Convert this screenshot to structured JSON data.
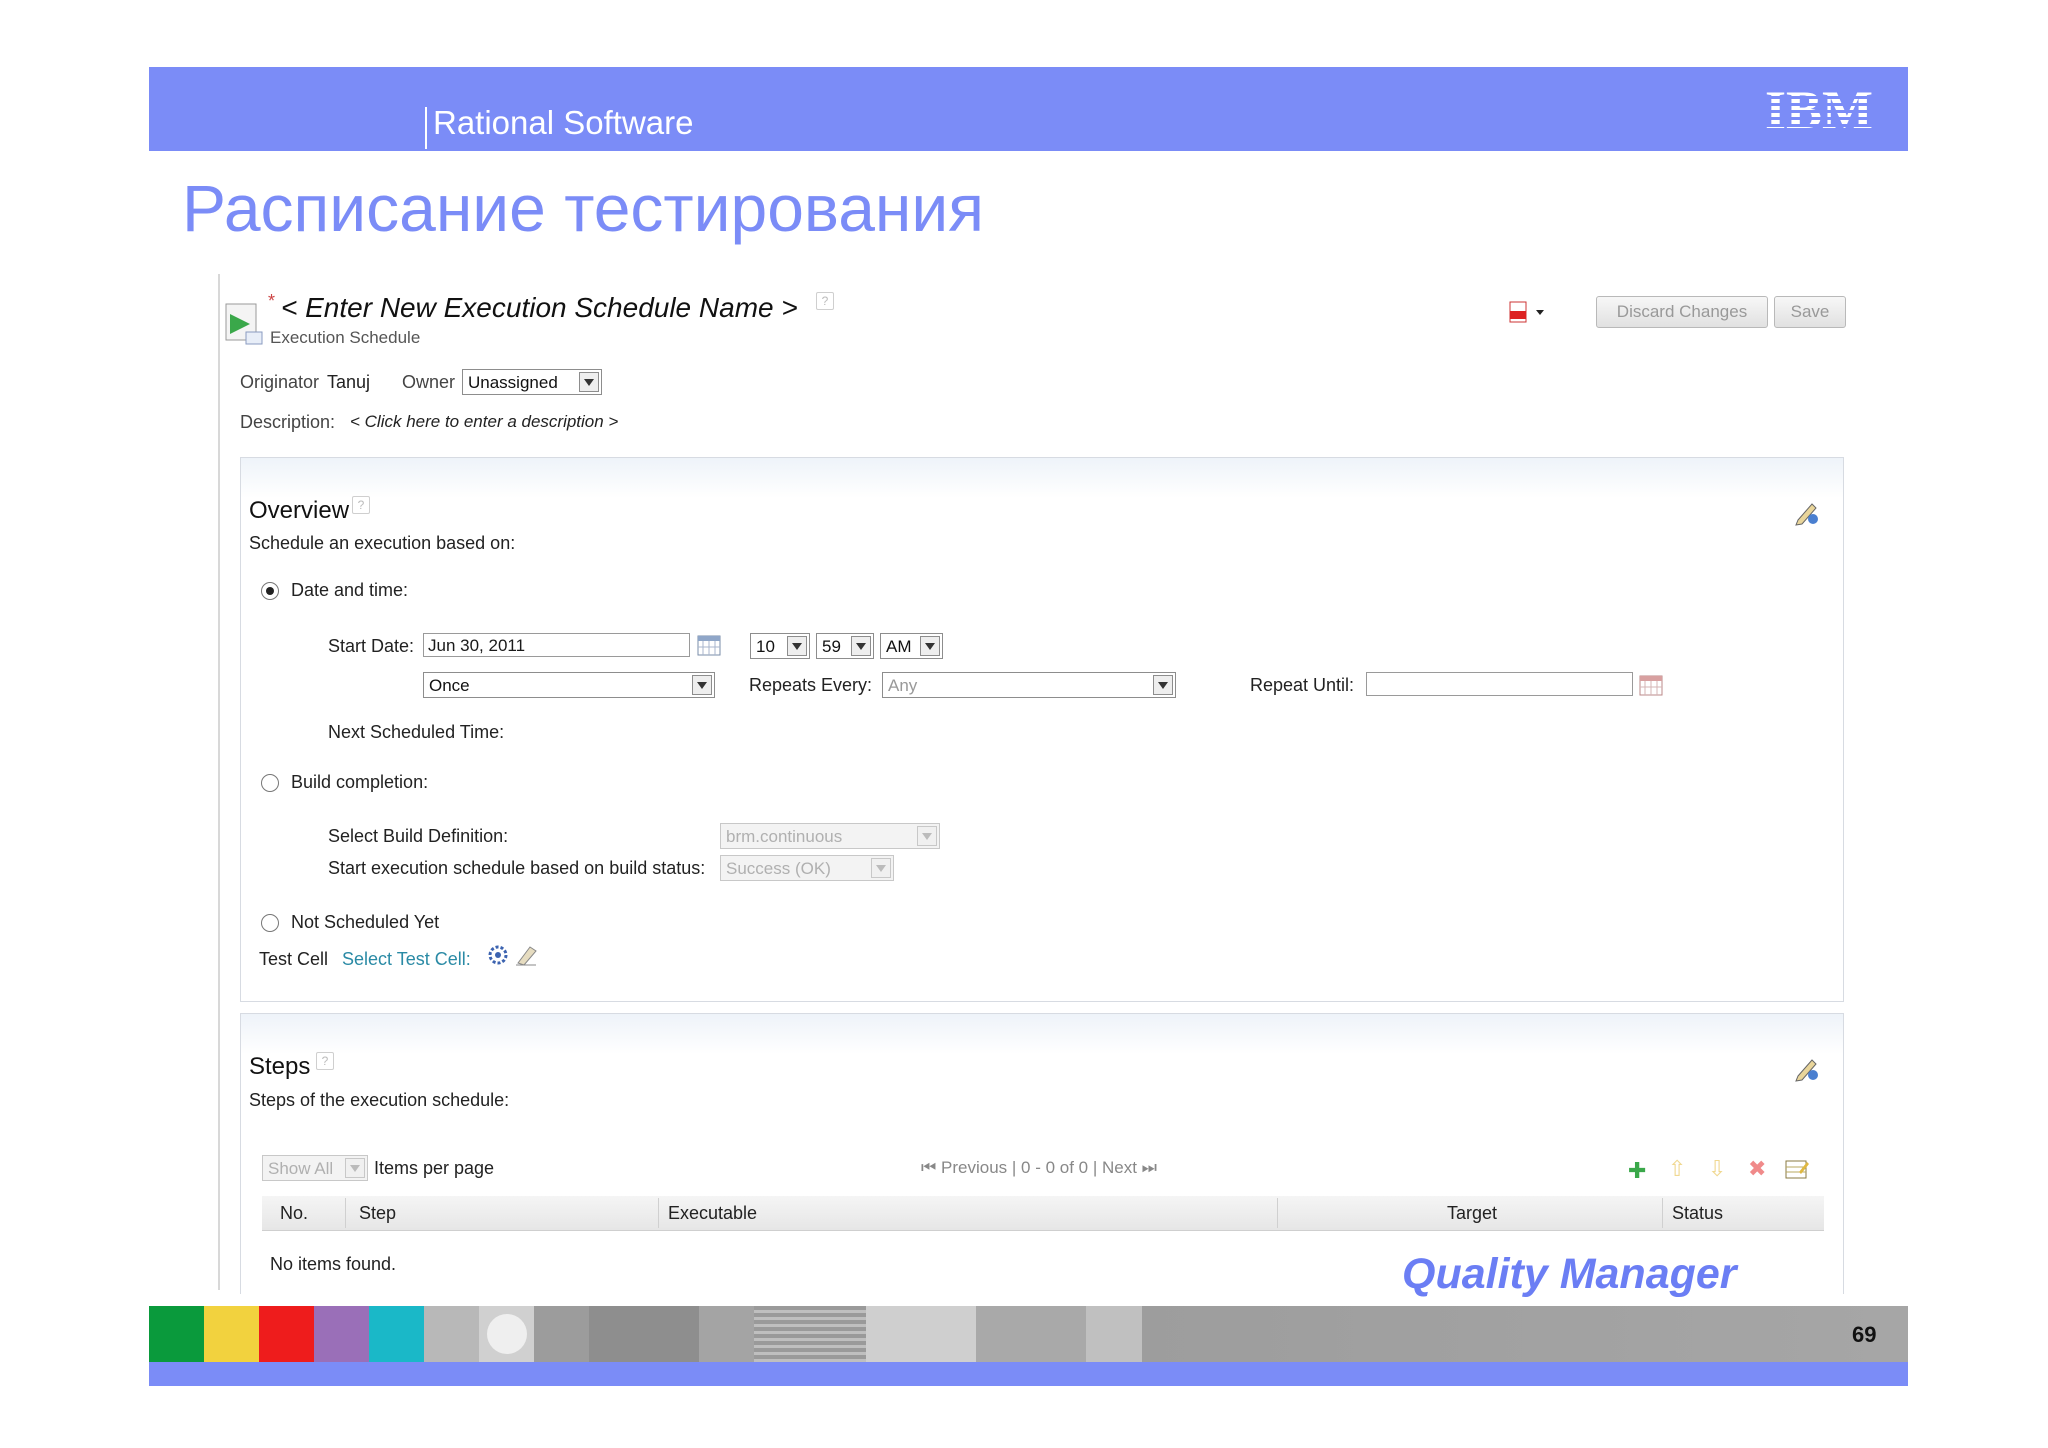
{
  "slide": {
    "header_label": "Rational Software",
    "logo_text": "IBM",
    "title": "Расписание тестирования",
    "brand_footer": "Quality Manager",
    "page_number": "69",
    "colors": {
      "accent": "#7b8cf7",
      "brand_text": "#6b7ef4"
    }
  },
  "app": {
    "schedule_name": "< Enter New Execution Schedule Name >",
    "asterisk": "*",
    "subtitle": "Execution Schedule",
    "pdf_icon": "pdf-icon",
    "buttons": {
      "discard": "Discard Changes",
      "save": "Save"
    },
    "originator_label": "Originator",
    "originator_value": "Tanuj",
    "owner_label": "Owner",
    "owner_value": "Unassigned",
    "description_label": "Description:",
    "description_placeholder": "< Click here to enter a description >",
    "overview": {
      "title": "Overview",
      "subtitle": "Schedule an execution based on:",
      "date_time_label": "Date and time:",
      "start_date_label": "Start Date:",
      "start_date_value": "Jun 30, 2011",
      "hour": "10",
      "minute": "59",
      "ampm": "AM",
      "frequency": "Once",
      "repeats_every_label": "Repeats Every:",
      "repeats_every_value": "Any",
      "repeat_until_label": "Repeat Until:",
      "repeat_until_value": "",
      "next_scheduled_label": "Next Scheduled Time:",
      "build_completion_label": "Build completion:",
      "select_build_label": "Select Build Definition:",
      "build_definition_value": "brm.continuous",
      "build_status_label": "Start execution schedule based on build status:",
      "build_status_value": "Success (OK)",
      "not_scheduled_label": "Not Scheduled Yet",
      "test_cell_label": "Test Cell",
      "select_test_cell_link": "Select Test Cell:",
      "selected_option": "date_time"
    },
    "steps": {
      "title": "Steps",
      "subtitle": "Steps of the execution schedule:",
      "show_select": "Show All",
      "items_per_page": "Items per page",
      "pager": "Previous | 0 - 0 of 0 | Next",
      "columns": [
        "No.",
        "Step",
        "Executable",
        "Target",
        "Status"
      ],
      "empty_message": "No items found."
    }
  },
  "footer_strip": {
    "colors": [
      "#0a9a3c",
      "#f2d23e",
      "#ee1c1c",
      "#9a6fb8",
      "#1ab8c8",
      "#b8b8b8",
      "#d0d0d0",
      "#9c9c9c",
      "#8e8e8e",
      "#a4a4a4",
      "#e0e0e0",
      "#cfcfcf",
      "#a9a9a9",
      "#c0c0c0",
      "#9d9d9d",
      "#a6a6a6"
    ]
  }
}
